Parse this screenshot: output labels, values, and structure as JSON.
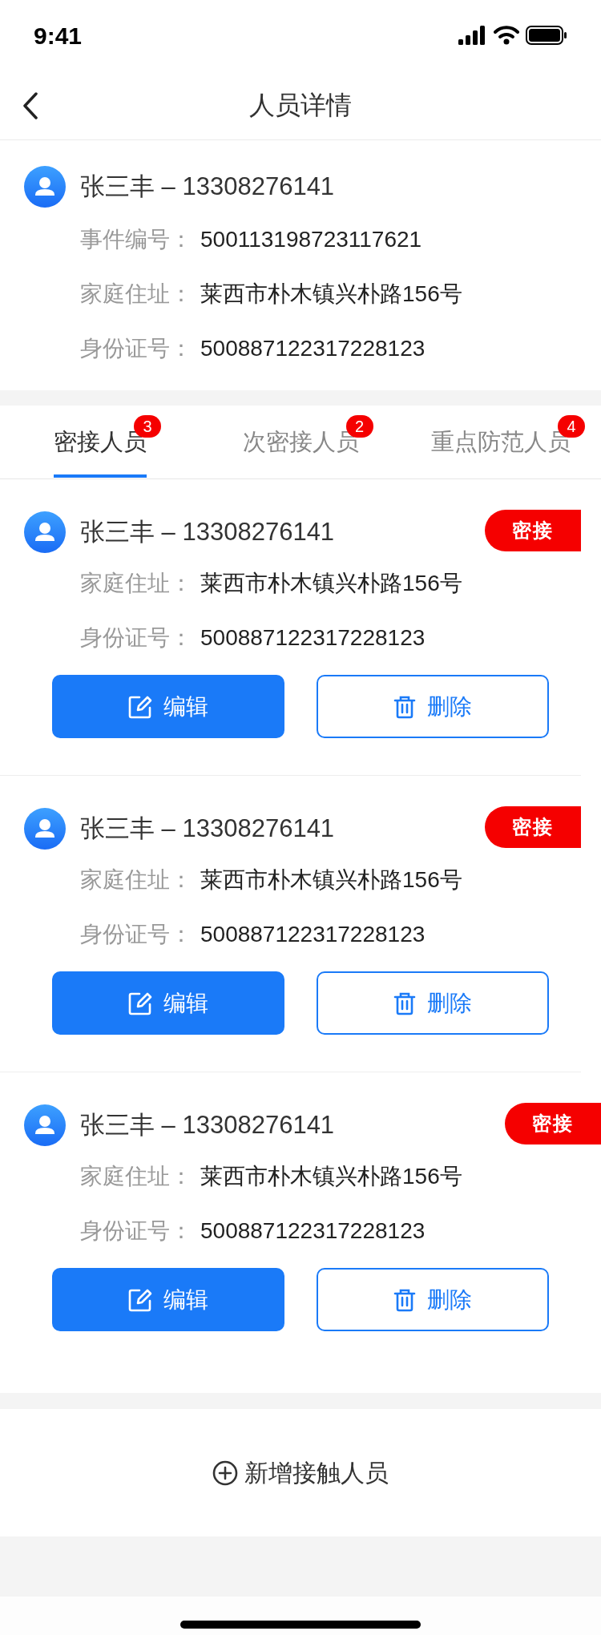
{
  "status_bar": {
    "time": "9:41"
  },
  "nav": {
    "title": "人员详情"
  },
  "person": {
    "name_phone": "张三丰 – 13308276141",
    "fields": [
      {
        "label": "事件编号：",
        "value": "500113198723117621"
      },
      {
        "label": "家庭住址：",
        "value": "莱西市朴木镇兴朴路156号"
      },
      {
        "label": "身份证号：",
        "value": "500887122317228123"
      }
    ]
  },
  "tabs": [
    {
      "label": "密接人员",
      "count": "3",
      "selected": true
    },
    {
      "label": "次密接人员",
      "count": "2",
      "selected": false
    },
    {
      "label": "重点防范人员",
      "count": "4",
      "selected": false
    }
  ],
  "contacts": [
    {
      "name_phone": "张三丰 – 13308276141",
      "tag": "密接",
      "fields": [
        {
          "label": "家庭住址：",
          "value": "莱西市朴木镇兴朴路156号"
        },
        {
          "label": "身份证号：",
          "value": "500887122317228123"
        }
      ],
      "edit": "编辑",
      "delete": "删除"
    },
    {
      "name_phone": "张三丰 – 13308276141",
      "tag": "密接",
      "fields": [
        {
          "label": "家庭住址：",
          "value": "莱西市朴木镇兴朴路156号"
        },
        {
          "label": "身份证号：",
          "value": "500887122317228123"
        }
      ],
      "edit": "编辑",
      "delete": "删除"
    },
    {
      "name_phone": "张三丰 – 13308276141",
      "tag": "密接",
      "fields": [
        {
          "label": "家庭住址：",
          "value": "莱西市朴木镇兴朴路156号"
        },
        {
          "label": "身份证号：",
          "value": "500887122317228123"
        }
      ],
      "edit": "编辑",
      "delete": "删除"
    }
  ],
  "add_button": "新增接触人员"
}
